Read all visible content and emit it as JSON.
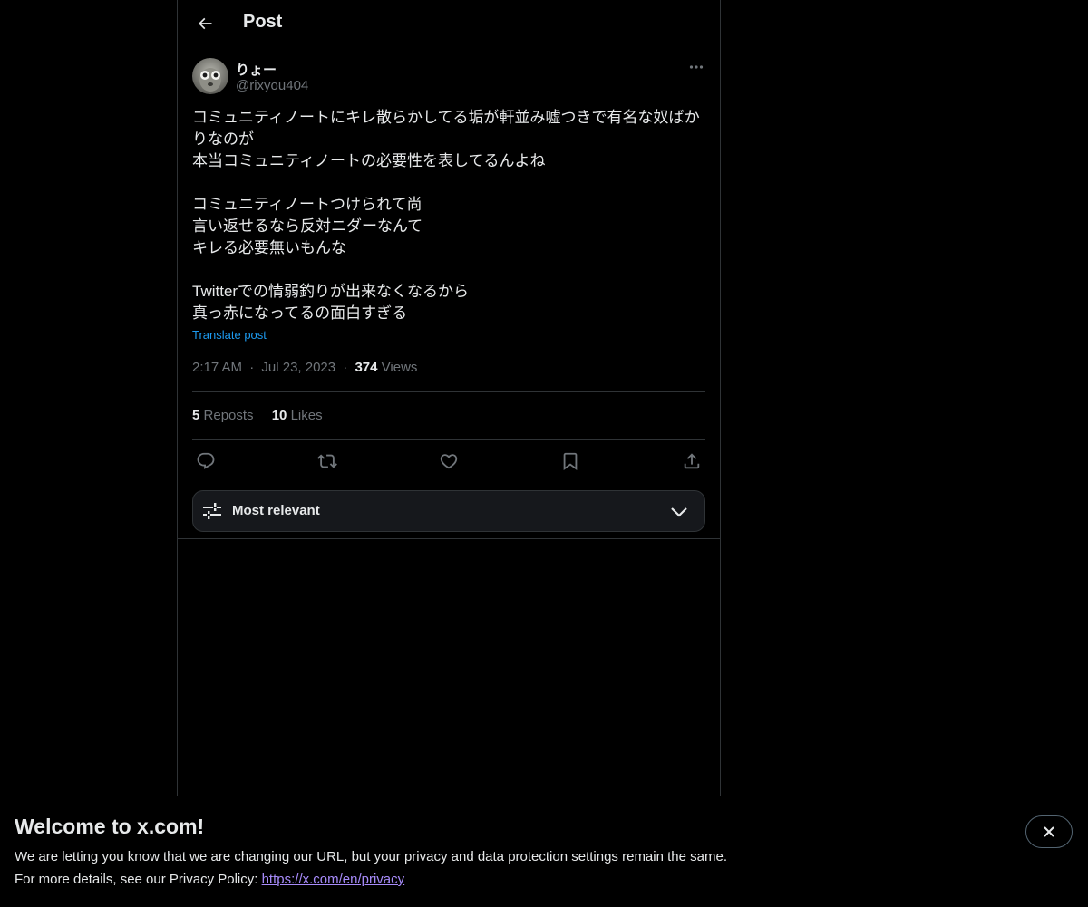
{
  "header": {
    "title": "Post"
  },
  "post": {
    "author_name": "りょー",
    "author_handle": "@rixyou404",
    "text_lines": [
      "コミュニティノートにキレ散らかしてる垢が軒並み嘘つきで有名な奴ばか",
      "りなのが",
      "本当コミュニティノートの必要性を表してるんよね",
      "",
      "コミュニティノートつけられて尚",
      "言い返せるなら反対ニダーなんて",
      "キレる必要無いもんな",
      "",
      "Twitterでの情弱釣りが出来なくなるから",
      "真っ赤になってるの面白すぎる"
    ],
    "translate_label": "Translate post",
    "time": "2:17 AM",
    "date": "Jul 23, 2023",
    "separator": "·",
    "views_count": "374",
    "views_label": "Views",
    "reposts_count": "5",
    "reposts_label": "Reposts",
    "likes_count": "10",
    "likes_label": "Likes"
  },
  "actions": {
    "icons": [
      "reply-icon",
      "repost-icon",
      "like-icon",
      "bookmark-icon",
      "share-icon"
    ]
  },
  "sort": {
    "label": "Most relevant"
  },
  "banner": {
    "title": "Welcome to x.com!",
    "line1": "We are letting you know that we are changing our URL, but your privacy and data protection settings remain the same.",
    "line2_prefix": "For more details, see our Privacy Policy: ",
    "link_text": "https://x.com/en/privacy"
  },
  "colors": {
    "background": "#000000",
    "text": "#e7e9ea",
    "muted": "#71767b",
    "accent": "#1d9bf0",
    "border": "#2f3336",
    "link": "#a78bfa"
  }
}
